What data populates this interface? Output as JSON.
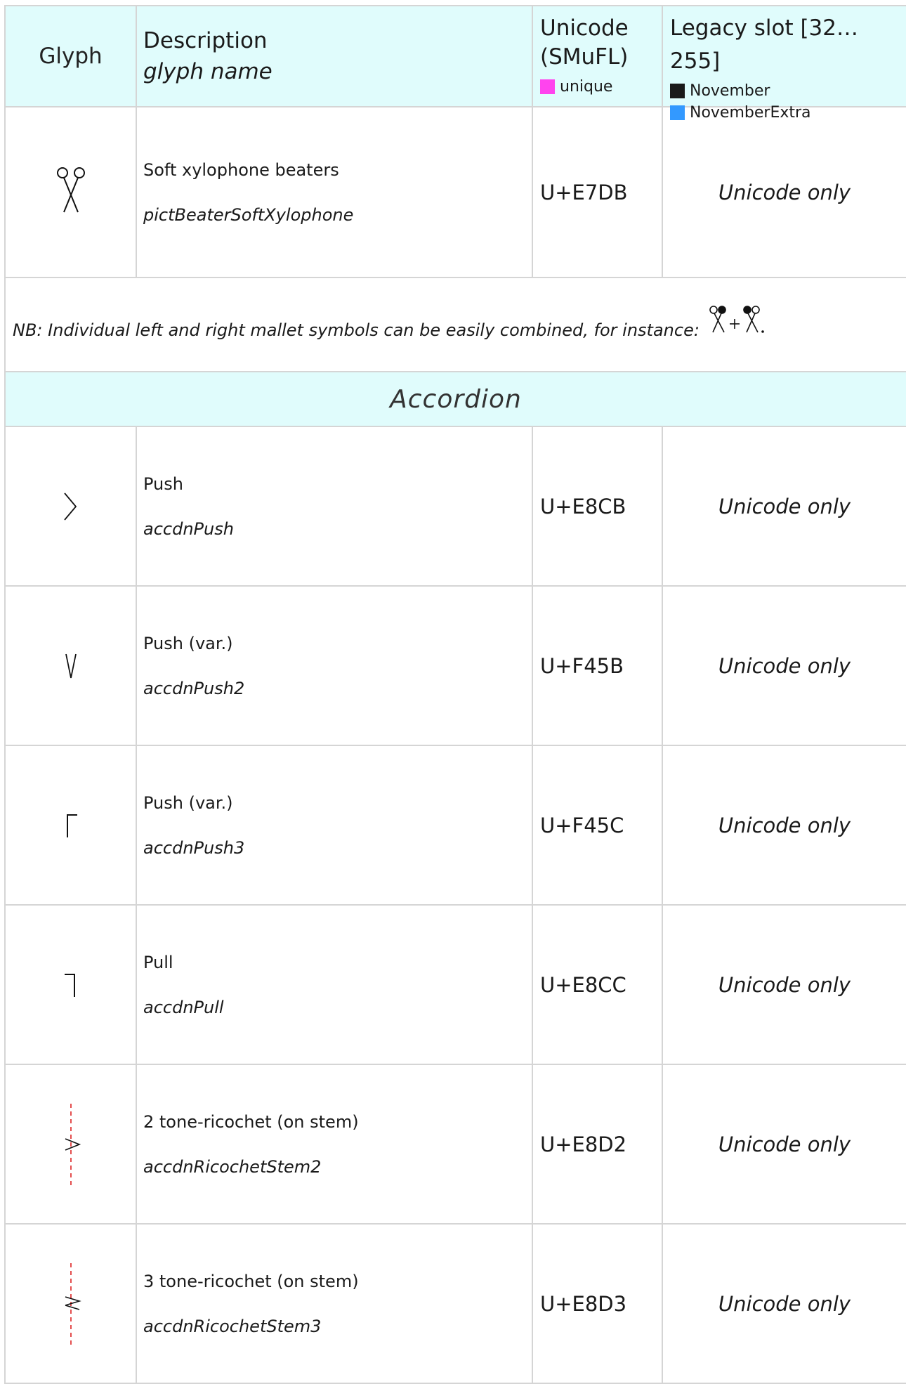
{
  "header": {
    "glyph": "Glyph",
    "description": "Description",
    "glyph_name": "glyph name",
    "unicode_line1": "Unicode",
    "unicode_line2": "(SMuFL)",
    "unicode_key": "unique",
    "legacy": "Legacy slot [32…255]",
    "legacy_key1": "November",
    "legacy_key2": "NovemberExtra"
  },
  "colors": {
    "header_bg": "#e0fcfc",
    "unique": "#ff44ee",
    "november": "#1a1a1a",
    "november_extra": "#3399ff",
    "ricochet_stem": "#dd2222"
  },
  "rows_top": [
    {
      "icon": "soft-xylophone-beaters-icon",
      "description": "Soft xylophone beaters",
      "name": "pictBeaterSoftXylophone",
      "unicode": "U+E7DB",
      "legacy": "Unicode only"
    }
  ],
  "note": "NB: Individual left and right mallet symbols can be easily combined, for instance:",
  "section": "Accordion",
  "rows": [
    {
      "icon": "push-icon",
      "description": "Push",
      "name": "accdnPush",
      "unicode": "U+E8CB",
      "legacy": "Unicode only"
    },
    {
      "icon": "push-var-icon",
      "description": "Push (var.)",
      "name": "accdnPush2",
      "unicode": "U+F45B",
      "legacy": "Unicode only"
    },
    {
      "icon": "push-var2-icon",
      "description": "Push (var.)",
      "name": "accdnPush3",
      "unicode": "U+F45C",
      "legacy": "Unicode only"
    },
    {
      "icon": "pull-icon",
      "description": "Pull",
      "name": "accdnPull",
      "unicode": "U+E8CC",
      "legacy": "Unicode only"
    },
    {
      "icon": "ricochet-stem-2-icon",
      "description": "2 tone-ricochet (on stem)",
      "name": "accdnRicochetStem2",
      "unicode": "U+E8D2",
      "legacy": "Unicode only"
    },
    {
      "icon": "ricochet-stem-3-icon",
      "description": "3 tone-ricochet (on stem)",
      "name": "accdnRicochetStem3",
      "unicode": "U+E8D3",
      "legacy": "Unicode only"
    }
  ]
}
